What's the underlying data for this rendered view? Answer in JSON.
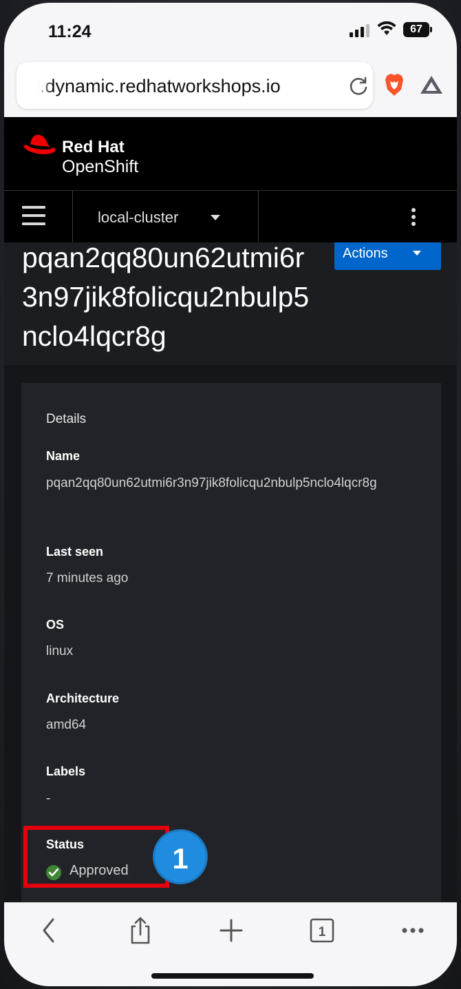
{
  "status_bar": {
    "time": "11:24",
    "battery": "67"
  },
  "browser": {
    "url": "l.dynamic.redhatworkshops.io"
  },
  "header": {
    "brand_line1": "Red Hat",
    "brand_line2": "OpenShift"
  },
  "nav": {
    "cluster": "local-cluster"
  },
  "page": {
    "title": "pqan2qq80un62utmi6r3n97jik8folicqu2nbulp5nclo4lqcr8g",
    "actions_label": "Actions"
  },
  "details": {
    "heading": "Details",
    "name_label": "Name",
    "name_value": "pqan2qq80un62utmi6r3n97jik8folicqu2nbulp5nclo4lqcr8g",
    "last_seen_label": "Last seen",
    "last_seen_value": "7 minutes ago",
    "os_label": "OS",
    "os_value": "linux",
    "arch_label": "Architecture",
    "arch_value": "amd64",
    "labels_label": "Labels",
    "labels_value": "-",
    "status_label": "Status",
    "status_value": "Approved"
  },
  "annotation": {
    "badge": "1"
  },
  "colors": {
    "accent": "#0066cc",
    "status_ok": "#3e8635",
    "highlight": "#e4000f",
    "badge": "#1f8ce0"
  },
  "icons": [
    "signal-icon",
    "wifi-icon",
    "battery-icon",
    "reload-icon",
    "brave-icon",
    "bat-icon",
    "redhat-hat-icon",
    "hamburger-icon",
    "caret-down-icon",
    "kebab-icon",
    "check-circle-icon",
    "back-icon",
    "share-icon",
    "plus-icon",
    "tabs-icon",
    "more-icon"
  ]
}
